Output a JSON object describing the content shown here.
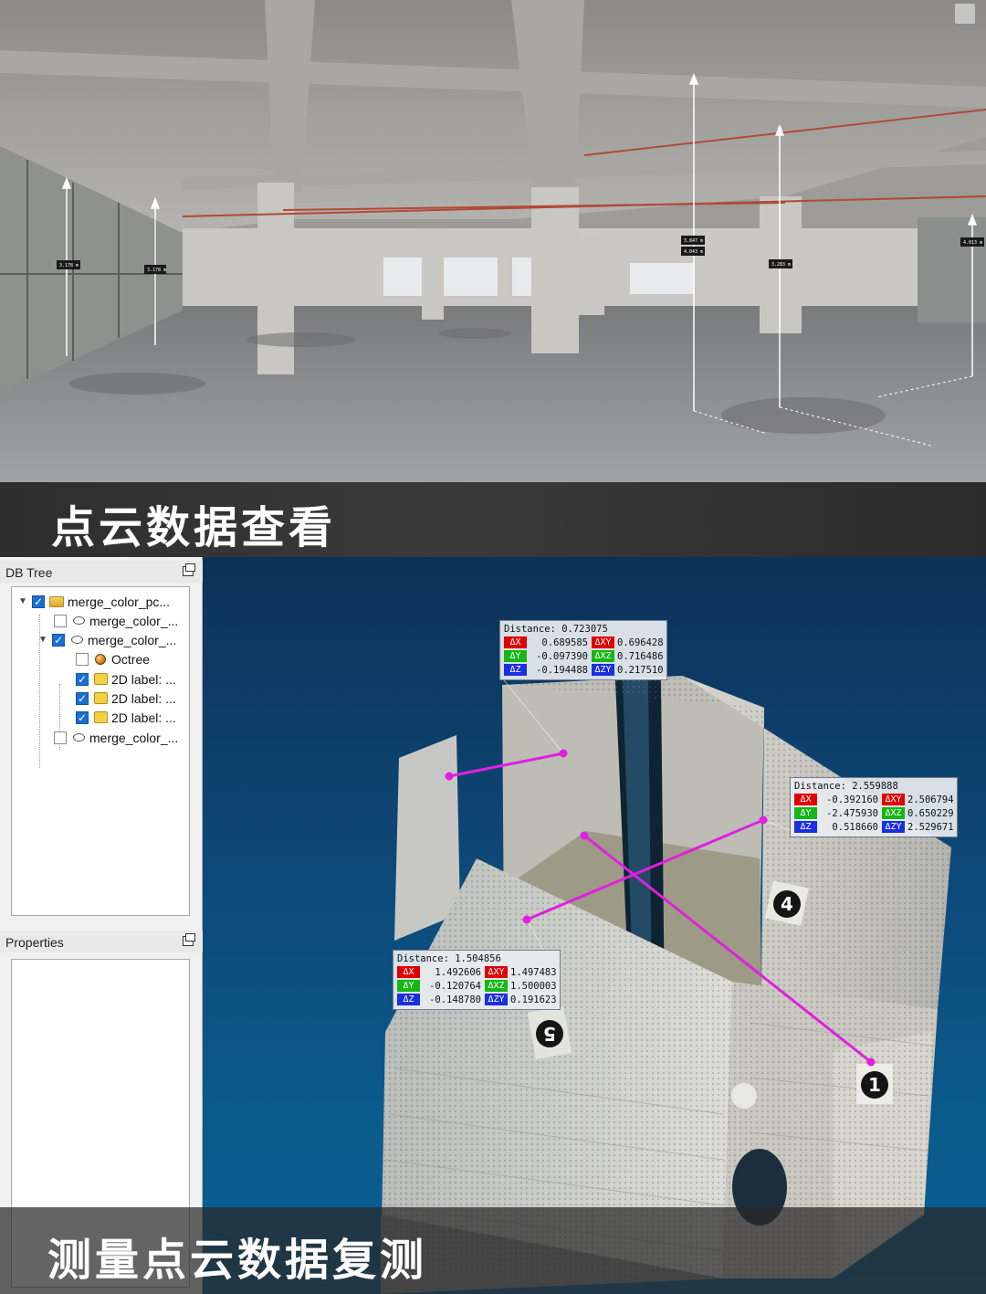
{
  "top": {
    "caption": "点云数据查看",
    "measure_tags": [
      "3.178 m",
      "3.178 m",
      "3.847 m",
      "4.043 m",
      "3.283 m",
      "4.013 m"
    ]
  },
  "app": {
    "db_tree": {
      "title": "DB Tree",
      "items": [
        {
          "label": "merge_color_pc...",
          "checked": true,
          "icon": "folder-icon",
          "expanded": true
        },
        {
          "label": "merge_color_...",
          "checked": false,
          "icon": "point-cloud-icon"
        },
        {
          "label": "merge_color_...",
          "checked": true,
          "icon": "point-cloud-icon",
          "expanded": true
        },
        {
          "label": "Octree",
          "checked": false,
          "icon": "octree-icon"
        },
        {
          "label": "2D label: ...",
          "checked": true,
          "icon": "label-icon"
        },
        {
          "label": "2D label: ...",
          "checked": true,
          "icon": "label-icon"
        },
        {
          "label": "2D label: ...",
          "checked": true,
          "icon": "label-icon"
        },
        {
          "label": "merge_color_...",
          "checked": false,
          "icon": "point-cloud-icon"
        }
      ]
    },
    "properties": {
      "title": "Properties"
    },
    "measurements": [
      {
        "title": "Distance: 0.723075",
        "rows": [
          {
            "tag1": "ΔX",
            "v1": "0.689585",
            "tag2": "ΔXY",
            "v2": "0.696428"
          },
          {
            "tag1": "ΔY",
            "v1": "-0.097390",
            "tag2": "ΔXZ",
            "v2": "0.716486"
          },
          {
            "tag1": "ΔZ",
            "v1": "-0.194488",
            "tag2": "ΔZY",
            "v2": "0.217510"
          }
        ]
      },
      {
        "title": "Distance: 2.559888",
        "rows": [
          {
            "tag1": "ΔX",
            "v1": "-0.392160",
            "tag2": "ΔXY",
            "v2": "2.506794"
          },
          {
            "tag1": "ΔY",
            "v1": "-2.475930",
            "tag2": "ΔXZ",
            "v2": "0.650229"
          },
          {
            "tag1": "ΔZ",
            "v1": "0.518660",
            "tag2": "ΔZY",
            "v2": "2.529671"
          }
        ]
      },
      {
        "title": "Distance: 1.504856",
        "rows": [
          {
            "tag1": "ΔX",
            "v1": "1.492606",
            "tag2": "ΔXY",
            "v2": "1.497483"
          },
          {
            "tag1": "ΔY",
            "v1": "-0.120764",
            "tag2": "ΔXZ",
            "v2": "1.500003"
          },
          {
            "tag1": "ΔZ",
            "v1": "-0.148780",
            "tag2": "ΔZY",
            "v2": "0.191623"
          }
        ]
      }
    ],
    "block_numbers": [
      "4",
      "5",
      "1"
    ],
    "colors": {
      "measure_line": "#e020e0",
      "viewport_bg": "#0d4a7a"
    }
  },
  "bottom": {
    "caption": "测量点云数据复测"
  }
}
